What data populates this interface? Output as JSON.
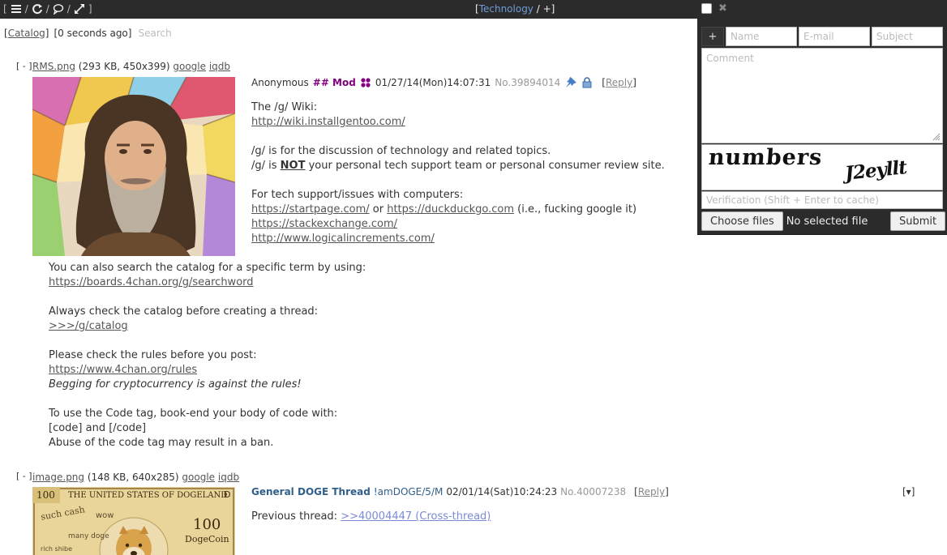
{
  "topbar": {
    "board_name": "Technology",
    "plus": "+"
  },
  "subhead": {
    "catalog_label": "Catalog",
    "updated": "[0 seconds ago]",
    "search_placeholder": "Search"
  },
  "threads": [
    {
      "toggle": "[ - ]",
      "file_name": "RMS.png",
      "file_meta": "(293 KB, 450x399)",
      "google": "google",
      "iqdb": "iqdb",
      "name": "Anonymous",
      "capcode": "## Mod",
      "date": "01/27/14(Mon)14:07:31",
      "post_no": "No.39894014",
      "reply_label": "Reply",
      "lines": [
        {
          "text": "The /g/ Wiki:"
        },
        {
          "link": "http://wiki.installgentoo.com/"
        },
        {
          "text": ""
        },
        {
          "text": "/g/ is for the discussion of technology and related topics."
        },
        {
          "pre": "/g/ is ",
          "bold": "NOT",
          "post": " your personal tech support team or personal consumer review site."
        },
        {
          "text": ""
        },
        {
          "text": "For tech support/issues with computers:"
        },
        {
          "link": "https://startpage.com/",
          "mid": " or ",
          "link2": "https://duckduckgo.com",
          "post": " (i.e., fucking google it)"
        },
        {
          "link": "https://stackexchange.com/"
        },
        {
          "link": "http://www.logicalincrements.com/"
        }
      ],
      "lines_below": [
        {
          "text": "You can also search the catalog for a specific term by using:"
        },
        {
          "link": "https://boards.4chan.org/g/searchword"
        },
        {
          "text": ""
        },
        {
          "text": "Always check the catalog before creating a thread:"
        },
        {
          "link": ">>>/g/catalog"
        },
        {
          "text": ""
        },
        {
          "text": "Please check the rules before you post:"
        },
        {
          "link": "https://www.4chan.org/rules"
        },
        {
          "italic": "Begging for cryptocurrency is against the rules!"
        },
        {
          "text": ""
        },
        {
          "text": "To use the Code tag, book-end your body of code with:"
        },
        {
          "text": "[code] and [/code]"
        },
        {
          "text": "Abuse of the code tag may result in a ban."
        }
      ]
    },
    {
      "toggle": "[ - ]",
      "file_name": "image.png",
      "file_meta": "(148 KB, 640x285)",
      "google": "google",
      "iqdb": "iqdb",
      "subject": "General DOGE Thread",
      "trip": "!amDOGE/5/M",
      "date": "02/01/14(Sat)10:24:23",
      "post_no": "No.40007238",
      "reply_label": "Reply",
      "menu": "[▾]",
      "body_prefix": "Previous thread: ",
      "quote_link": ">>40004447 (Cross-thread)",
      "banknote": {
        "denom": "100",
        "country": "THE UNITED STATES OF DOGELAND",
        "symbol": "Ð",
        "coin_label": "DogeCoin",
        "such": "such cash",
        "wow": "wow",
        "many": "many doge",
        "rich": "rich shibe"
      }
    }
  ],
  "qr": {
    "plus": "+",
    "name_placeholder": "Name",
    "email_placeholder": "E-mail",
    "subject_placeholder": "Subject",
    "comment_placeholder": "Comment",
    "captcha_word1": "numbers",
    "captcha_word2": "J2eyllt",
    "verification_placeholder": "Verification (Shift + Enter to cache)",
    "choose_files": "Choose files",
    "no_file": "No selected file",
    "submit": "Submit"
  }
}
